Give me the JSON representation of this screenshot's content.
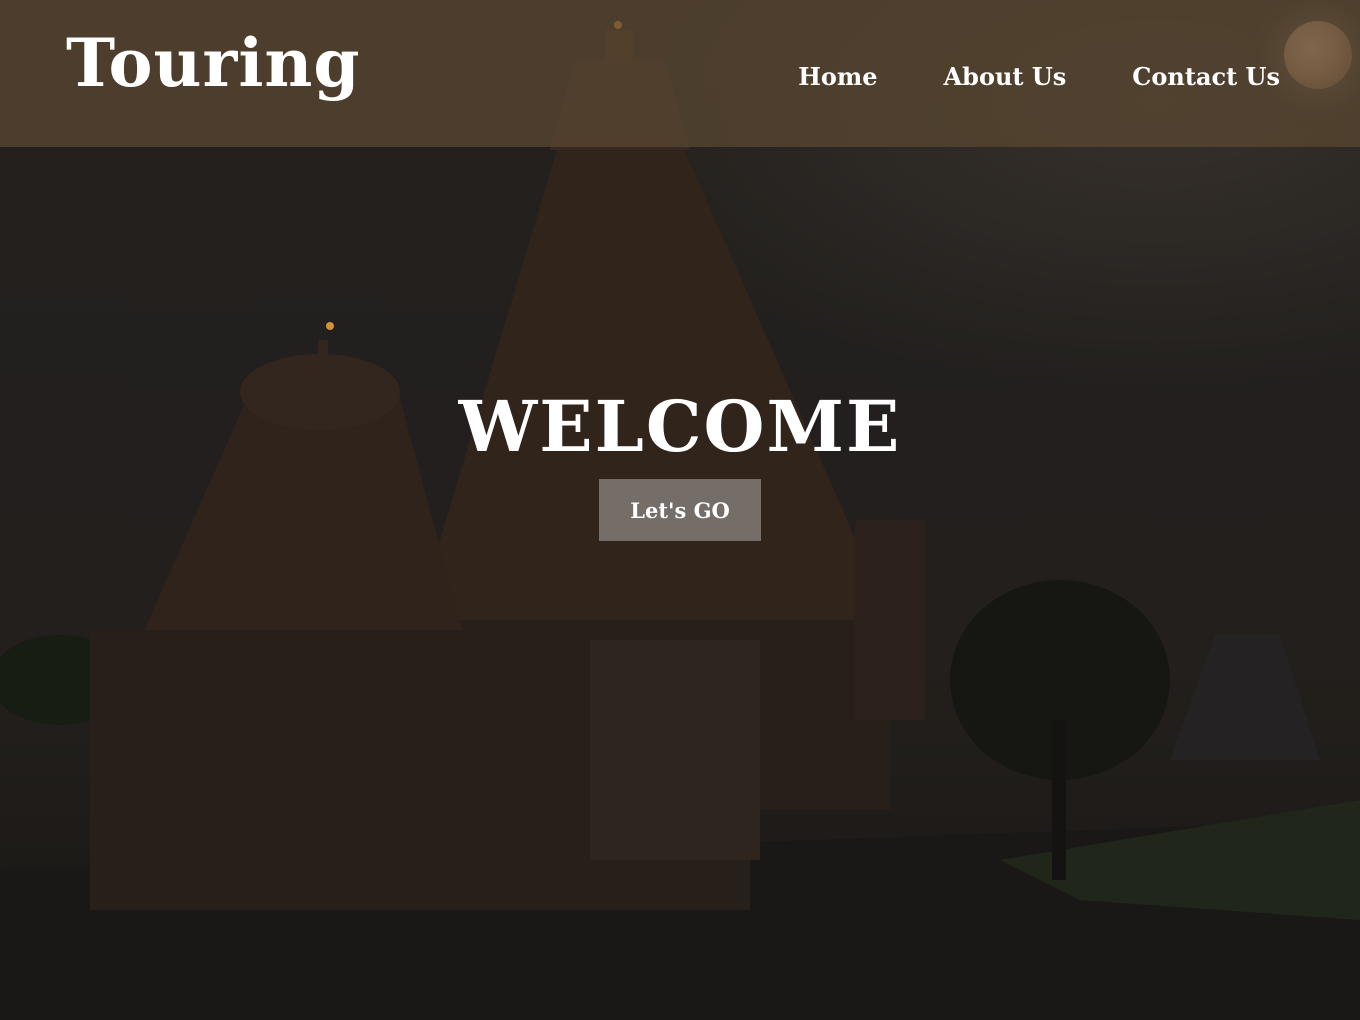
{
  "brand": {
    "name": "Touring"
  },
  "nav": {
    "items": [
      {
        "label": "Home"
      },
      {
        "label": "About Us"
      },
      {
        "label": "Contact Us"
      }
    ]
  },
  "hero": {
    "heading": "WELCOME",
    "cta_label": "Let's GO",
    "background_image": "temple-at-dusk"
  },
  "colors": {
    "header_bg": "#5c4832",
    "text": "#ffffff",
    "cta_bg": "#9a9a9a"
  }
}
